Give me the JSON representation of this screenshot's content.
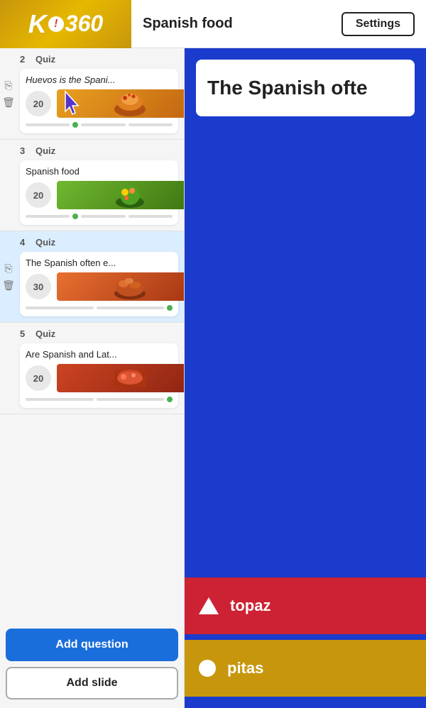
{
  "header": {
    "logo_text": "K!360",
    "title": "Spanish food",
    "settings_label": "Settings"
  },
  "sidebar": {
    "sections": [
      {
        "number": "2",
        "type": "Quiz",
        "title": "Huevos is the Spani...",
        "title_italic": true,
        "points": "20",
        "active": false,
        "has_cursor": true
      },
      {
        "number": "3",
        "type": "Quiz",
        "title": "Spanish food",
        "title_italic": false,
        "points": "20",
        "active": false,
        "has_cursor": false
      },
      {
        "number": "4",
        "type": "Quiz",
        "title": "The Spanish often e...",
        "title_italic": false,
        "points": "30",
        "active": true,
        "has_cursor": false
      },
      {
        "number": "5",
        "type": "Quiz",
        "title": "Are Spanish and Lat...",
        "title_italic": false,
        "points": "20",
        "active": false,
        "has_cursor": false
      }
    ],
    "add_question_label": "Add question",
    "add_slide_label": "Add slide"
  },
  "main": {
    "question_text": "The Spanish ofte",
    "answers": [
      {
        "label": "topaz",
        "shape": "triangle",
        "color": "red"
      },
      {
        "label": "pitas",
        "shape": "circle",
        "color": "gold"
      }
    ]
  }
}
